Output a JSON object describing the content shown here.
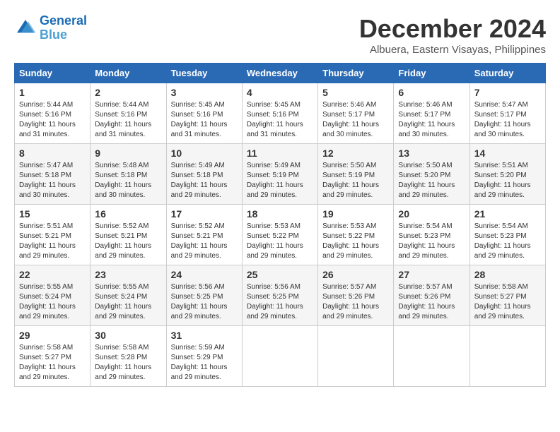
{
  "header": {
    "logo_line1": "General",
    "logo_line2": "Blue",
    "month_title": "December 2024",
    "location": "Albuera, Eastern Visayas, Philippines"
  },
  "weekdays": [
    "Sunday",
    "Monday",
    "Tuesday",
    "Wednesday",
    "Thursday",
    "Friday",
    "Saturday"
  ],
  "weeks": [
    [
      {
        "day": "1",
        "sunrise": "5:44 AM",
        "sunset": "5:16 PM",
        "daylight": "11 hours and 31 minutes."
      },
      {
        "day": "2",
        "sunrise": "5:44 AM",
        "sunset": "5:16 PM",
        "daylight": "11 hours and 31 minutes."
      },
      {
        "day": "3",
        "sunrise": "5:45 AM",
        "sunset": "5:16 PM",
        "daylight": "11 hours and 31 minutes."
      },
      {
        "day": "4",
        "sunrise": "5:45 AM",
        "sunset": "5:16 PM",
        "daylight": "11 hours and 31 minutes."
      },
      {
        "day": "5",
        "sunrise": "5:46 AM",
        "sunset": "5:17 PM",
        "daylight": "11 hours and 30 minutes."
      },
      {
        "day": "6",
        "sunrise": "5:46 AM",
        "sunset": "5:17 PM",
        "daylight": "11 hours and 30 minutes."
      },
      {
        "day": "7",
        "sunrise": "5:47 AM",
        "sunset": "5:17 PM",
        "daylight": "11 hours and 30 minutes."
      }
    ],
    [
      {
        "day": "8",
        "sunrise": "5:47 AM",
        "sunset": "5:18 PM",
        "daylight": "11 hours and 30 minutes."
      },
      {
        "day": "9",
        "sunrise": "5:48 AM",
        "sunset": "5:18 PM",
        "daylight": "11 hours and 30 minutes."
      },
      {
        "day": "10",
        "sunrise": "5:49 AM",
        "sunset": "5:18 PM",
        "daylight": "11 hours and 29 minutes."
      },
      {
        "day": "11",
        "sunrise": "5:49 AM",
        "sunset": "5:19 PM",
        "daylight": "11 hours and 29 minutes."
      },
      {
        "day": "12",
        "sunrise": "5:50 AM",
        "sunset": "5:19 PM",
        "daylight": "11 hours and 29 minutes."
      },
      {
        "day": "13",
        "sunrise": "5:50 AM",
        "sunset": "5:20 PM",
        "daylight": "11 hours and 29 minutes."
      },
      {
        "day": "14",
        "sunrise": "5:51 AM",
        "sunset": "5:20 PM",
        "daylight": "11 hours and 29 minutes."
      }
    ],
    [
      {
        "day": "15",
        "sunrise": "5:51 AM",
        "sunset": "5:21 PM",
        "daylight": "11 hours and 29 minutes."
      },
      {
        "day": "16",
        "sunrise": "5:52 AM",
        "sunset": "5:21 PM",
        "daylight": "11 hours and 29 minutes."
      },
      {
        "day": "17",
        "sunrise": "5:52 AM",
        "sunset": "5:21 PM",
        "daylight": "11 hours and 29 minutes."
      },
      {
        "day": "18",
        "sunrise": "5:53 AM",
        "sunset": "5:22 PM",
        "daylight": "11 hours and 29 minutes."
      },
      {
        "day": "19",
        "sunrise": "5:53 AM",
        "sunset": "5:22 PM",
        "daylight": "11 hours and 29 minutes."
      },
      {
        "day": "20",
        "sunrise": "5:54 AM",
        "sunset": "5:23 PM",
        "daylight": "11 hours and 29 minutes."
      },
      {
        "day": "21",
        "sunrise": "5:54 AM",
        "sunset": "5:23 PM",
        "daylight": "11 hours and 29 minutes."
      }
    ],
    [
      {
        "day": "22",
        "sunrise": "5:55 AM",
        "sunset": "5:24 PM",
        "daylight": "11 hours and 29 minutes."
      },
      {
        "day": "23",
        "sunrise": "5:55 AM",
        "sunset": "5:24 PM",
        "daylight": "11 hours and 29 minutes."
      },
      {
        "day": "24",
        "sunrise": "5:56 AM",
        "sunset": "5:25 PM",
        "daylight": "11 hours and 29 minutes."
      },
      {
        "day": "25",
        "sunrise": "5:56 AM",
        "sunset": "5:25 PM",
        "daylight": "11 hours and 29 minutes."
      },
      {
        "day": "26",
        "sunrise": "5:57 AM",
        "sunset": "5:26 PM",
        "daylight": "11 hours and 29 minutes."
      },
      {
        "day": "27",
        "sunrise": "5:57 AM",
        "sunset": "5:26 PM",
        "daylight": "11 hours and 29 minutes."
      },
      {
        "day": "28",
        "sunrise": "5:58 AM",
        "sunset": "5:27 PM",
        "daylight": "11 hours and 29 minutes."
      }
    ],
    [
      {
        "day": "29",
        "sunrise": "5:58 AM",
        "sunset": "5:27 PM",
        "daylight": "11 hours and 29 minutes."
      },
      {
        "day": "30",
        "sunrise": "5:58 AM",
        "sunset": "5:28 PM",
        "daylight": "11 hours and 29 minutes."
      },
      {
        "day": "31",
        "sunrise": "5:59 AM",
        "sunset": "5:29 PM",
        "daylight": "11 hours and 29 minutes."
      },
      null,
      null,
      null,
      null
    ]
  ]
}
